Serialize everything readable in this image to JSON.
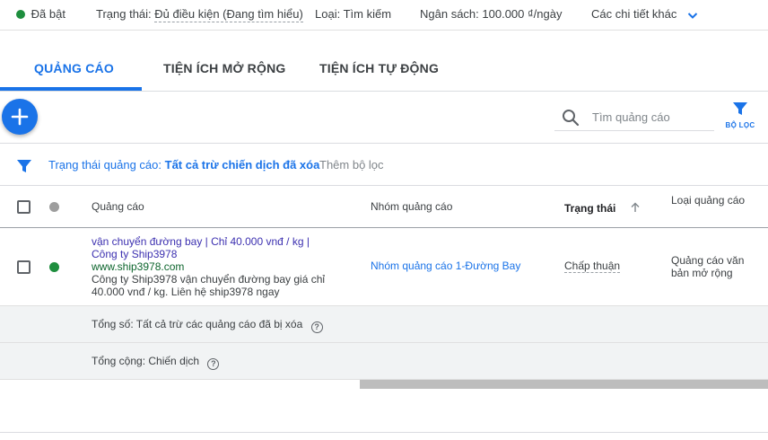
{
  "topbar": {
    "enabled_label": "Đã bật",
    "status_label": "Trạng thái:",
    "status_value": "Đủ điều kiện (Đang tìm hiểu)",
    "type_label": "Loại:",
    "type_value": "Tìm kiếm",
    "budget_label": "Ngân sách:",
    "budget_value": "100.000 ₫/ngày",
    "more_details": "Các chi tiết khác"
  },
  "tabs": [
    {
      "label": "QUẢNG CÁO",
      "active": true
    },
    {
      "label": "TIỆN ÍCH MỞ RỘNG",
      "active": false
    },
    {
      "label": "TIỆN ÍCH TỰ ĐỘNG",
      "active": false
    }
  ],
  "toolbar": {
    "add_symbol": "+",
    "search_placeholder": "Tìm quảng cáo",
    "filter_label": "BỘ LỌC"
  },
  "filterbar": {
    "chip_prefix": "Trạng thái quảng cáo:",
    "chip_value": "Tất cả trừ chiến dịch đã xóa",
    "add_filter": "Thêm bộ lọc"
  },
  "table": {
    "headers": {
      "ad": "Quảng cáo",
      "ad_group": "Nhóm quảng cáo",
      "status": "Trạng thái",
      "ad_type": "Loại quảng cáo"
    },
    "rows": [
      {
        "title": "vận chuyển đường bay | Chỉ 40.000 vnđ / kg | Công ty Ship3978",
        "url": "www.ship3978.com",
        "description": "Công ty Ship3978 vận chuyển đường bay giá chỉ 40.000 vnđ / kg. Liên hệ ship3978 ngay",
        "ad_group": "Nhóm quảng cáo 1-Đường Bay",
        "status": "Chấp thuận",
        "ad_type": "Quảng cáo văn bản mở rộng"
      }
    ],
    "totals": [
      {
        "label": "Tổng số: Tất cả trừ các quảng cáo đã bị xóa"
      },
      {
        "label": "Tổng cộng: Chiến dịch"
      }
    ]
  },
  "colors": {
    "accent": "#1a73e8",
    "enabled_green": "#1e8e3e",
    "header_status_dot": "#9e9e9e",
    "url_green": "#0d652d"
  }
}
